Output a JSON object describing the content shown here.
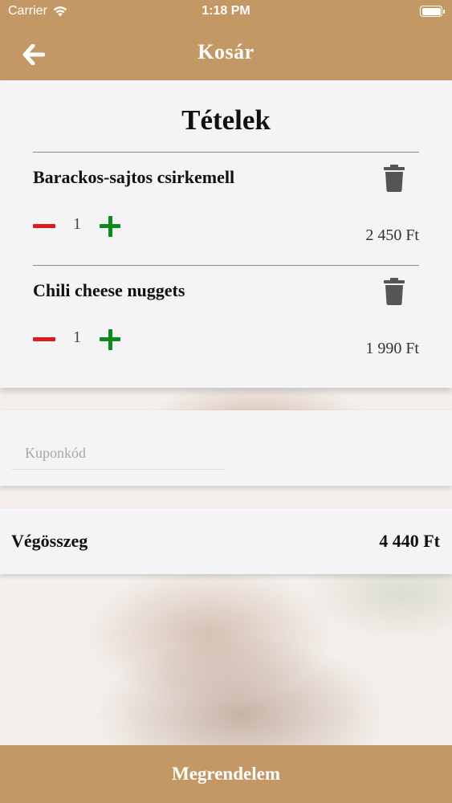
{
  "status_bar": {
    "carrier": "Carrier",
    "time": "1:18 PM",
    "battery_level": 1.0
  },
  "header": {
    "title": "Kosár",
    "back_icon": "arrow-left-icon"
  },
  "cart": {
    "title": "Tételek",
    "items": [
      {
        "name": "Barackos-sajtos csirkemell",
        "quantity": "1",
        "price": "2 450 Ft"
      },
      {
        "name": "Chili cheese nuggets",
        "quantity": "1",
        "price": "1 990 Ft"
      }
    ]
  },
  "coupon": {
    "placeholder": "Kuponkód",
    "value": ""
  },
  "total": {
    "label": "Végösszeg",
    "value": "4 440 Ft"
  },
  "order_button": {
    "label": "Megrendelem"
  },
  "colors": {
    "brand": "#c39865",
    "minus": "#e01a1a",
    "plus": "#0b8a1a",
    "trash": "#555555"
  }
}
